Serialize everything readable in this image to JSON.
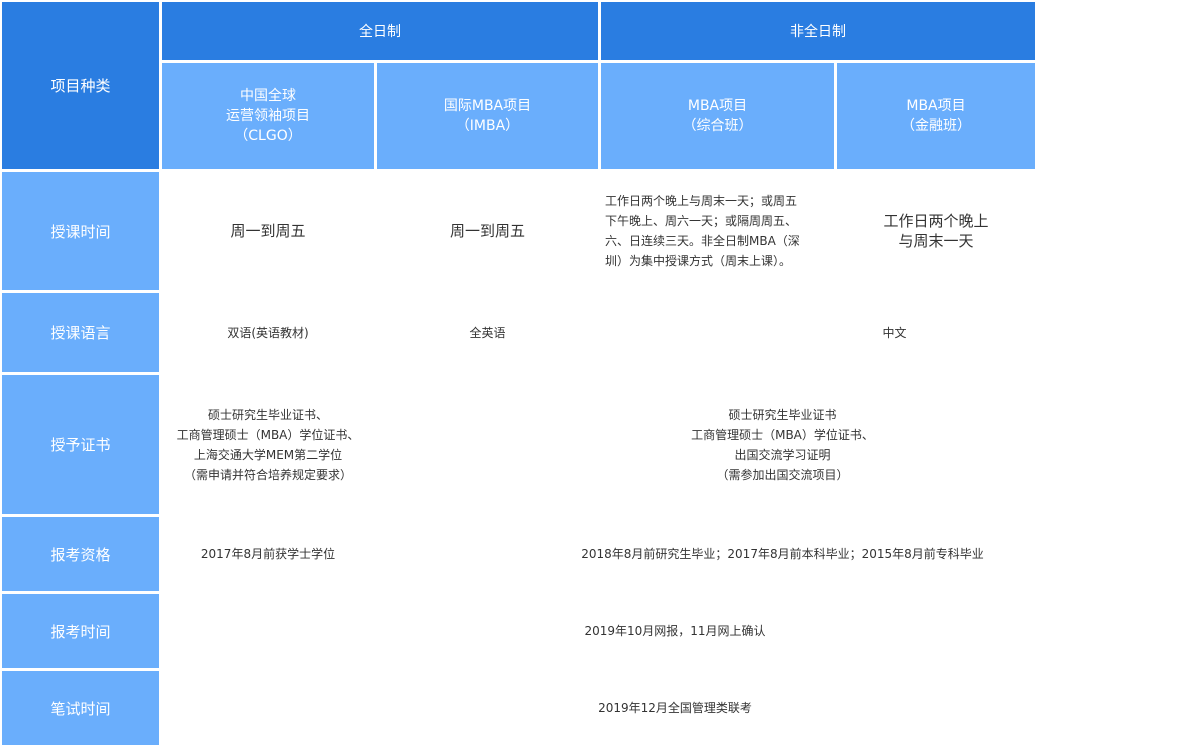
{
  "header": {
    "category_label": "项目种类",
    "full_time": "全日制",
    "part_time": "非全日制",
    "programs": [
      {
        "lines": [
          "中国全球",
          "运营领袖项目",
          "（CLGO）"
        ]
      },
      {
        "lines": [
          "国际MBA项目",
          "（IMBA）"
        ]
      },
      {
        "lines": [
          "MBA项目",
          "（综合班）"
        ]
      },
      {
        "lines": [
          "MBA项目",
          "（金融班）"
        ]
      }
    ]
  },
  "rows": {
    "schedule": {
      "label": "授课时间",
      "clgo": "周一到周五",
      "imba": "周一到周五",
      "mba_general": [
        "工作日两个晚上与周末一天；或周五",
        "下午晚上、周六一天；或隔周周五、",
        "六、日连续三天。非全日制MBA（深",
        "圳）为集中授课方式（周末上课）。"
      ],
      "mba_finance": [
        "工作日两个晚上",
        "与周末一天"
      ]
    },
    "language": {
      "label": "授课语言",
      "clgo": "双语(英语教材)",
      "imba": "全英语",
      "part_time": "中文"
    },
    "certificate": {
      "label": "授予证书",
      "clgo": [
        "硕士研究生毕业证书、",
        "工商管理硕士（MBA）学位证书、",
        "上海交通大学MEM第二学位",
        "（需申请并符合培养规定要求）"
      ],
      "others": [
        "硕士研究生毕业证书",
        "工商管理硕士（MBA）学位证书、",
        "出国交流学习证明",
        "（需参加出国交流项目）"
      ]
    },
    "eligibility": {
      "label": "报考资格",
      "clgo": "2017年8月前获学士学位",
      "others": "2018年8月前研究生毕业；2017年8月前本科毕业；2015年8月前专科毕业"
    },
    "registration": {
      "label": "报考时间",
      "all": "2019年10月网报，11月网上确认"
    },
    "exam": {
      "label": "笔试时间",
      "all": "2019年12月全国管理类联考"
    }
  }
}
